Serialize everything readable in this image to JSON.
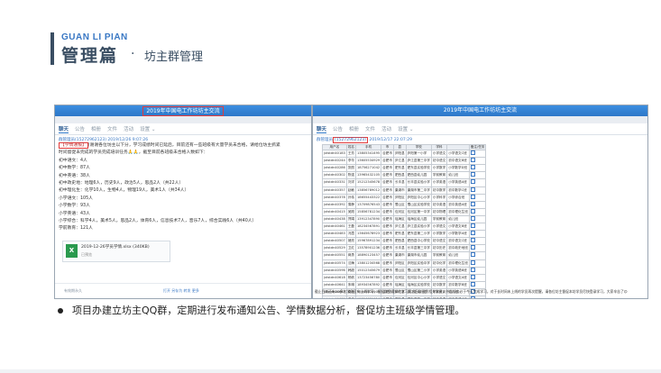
{
  "header": {
    "sub": "GUAN LI PIAN",
    "title": "管理篇",
    "dot": "·",
    "section": "坊主群管理"
  },
  "left_shot": {
    "window_title": "2019年中国电工作坊坊主交流",
    "tabs": [
      "聊天",
      "公告",
      "相册",
      "文件",
      "活动",
      "设置"
    ],
    "tab_suffix": "⌄",
    "meta": "群管理员(15272962123) 2019/12/26 9:07:26",
    "post_tag": "【学情通报】",
    "post_lines": [
      "(谢谢各位坊主以下分，学习成绩时间已延后，目前还有一些班级有大量学员未合格，请给位坊主抓紧",
      "时间督促未完成的学员完成培训任务🙏🙏，截至目前各班级未合格人数如下：",
      "初中语文：4人",
      "初中数学：87人",
      "初中英语：38人",
      "初中政史地：地理6人，历史9人，政治5人，思品2人（共22人）",
      "初中理化生：化学10人，生物4人，物理19人，美术1人（共34人）",
      "小学语文：105人",
      "小学数学：93人",
      "小学英语：43人",
      "小学综合：科学4人，美术5人，思品2人，体育6人，信息技术7人，音乐7人，综合实践6人（共40人）",
      "学前教育：121人"
    ],
    "file": {
      "icon": "X",
      "name": "2019-12-26学员学情.xlsx",
      "size": "(340KB)",
      "status": "已预览"
    },
    "footer_left": "有效期永久",
    "footer_right": "打开  另存为  转发  更多"
  },
  "right_shot": {
    "window_title": "2019年中国电工作坊坊主交流",
    "tabs": [
      "聊天",
      "公告",
      "相册",
      "文件",
      "活动",
      "设置"
    ],
    "tab_suffix": "⌄",
    "meta_prefix": "群管理员",
    "meta_hl": "(15272962123)",
    "meta_time": "2019/12/17 22:07:29",
    "columns": [
      "用户名",
      "姓名",
      "手机",
      "市",
      "县",
      "学校",
      "学科",
      "",
      "备注/任务"
    ],
    "rows": [
      [
        "jxtstdn40183",
        "王芳",
        "13805341495",
        "合肥市",
        "庐阳县",
        "庐阳第一小学",
        "小学语文",
        "小学语文C班",
        ""
      ],
      [
        "jxtstdn40244",
        "李华",
        "13605534929",
        "合肥市",
        "庐江县",
        "庐江县第三中学",
        "初中语文",
        "初中语文B班",
        ""
      ],
      [
        "jxtstdn40286",
        "张丽",
        "18756271042",
        "合肥市",
        "肥东县",
        "肥东县实验学校",
        "小学数学",
        "小学数学D班",
        ""
      ],
      [
        "jxtstdn40302",
        "陈强",
        "13965432105",
        "合肥市",
        "肥西县",
        "肥西县幼儿园",
        "学前教育",
        "幼儿班",
        ""
      ],
      [
        "jxtstdn40331",
        "刘洋",
        "15212345678",
        "合肥市",
        "长丰县",
        "长丰县实验小学",
        "小学英语",
        "小学英语A班",
        ""
      ],
      [
        "jxtstdn40357",
        "赵敏",
        "13856789012",
        "合肥市",
        "巢湖市",
        "巢湖市第二中学",
        "初中数学",
        "初中数学C班",
        ""
      ],
      [
        "jxtstdn40378",
        "孙伟",
        "18655443322",
        "合肥市",
        "庐阳区",
        "庐阳区中心小学",
        "小学科学",
        "小学综合班",
        ""
      ],
      [
        "jxtstdn40392",
        "周静",
        "13709876543",
        "合肥市",
        "蜀山区",
        "蜀山区实验学校",
        "初中英语",
        "初中英语A班",
        ""
      ],
      [
        "jxtstdn40415",
        "吴刚",
        "15856781234",
        "合肥市",
        "包河区",
        "包河区第一中学",
        "初中物理",
        "初中理化生班",
        ""
      ],
      [
        "jxtstdn40438",
        "郑娟",
        "13912347890",
        "合肥市",
        "瑶海区",
        "瑶海区幼儿园",
        "学前教育",
        "幼儿班",
        ""
      ],
      [
        "jxtstdn40461",
        "王磊",
        "18234567891",
        "合肥市",
        "庐江县",
        "庐江县实验小学",
        "小学语文",
        "小学语文B班",
        ""
      ],
      [
        "jxtstdn40483",
        "冯霞",
        "13645678923",
        "合肥市",
        "肥东县",
        "肥东县第二小学",
        "小学数学",
        "小学数学A班",
        ""
      ],
      [
        "jxtstdn40507",
        "褚亮",
        "15967891234",
        "合肥市",
        "肥西县",
        "肥西县中心学校",
        "初中语文",
        "初中语文C班",
        ""
      ],
      [
        "jxtstdn40529",
        "卫红",
        "13578901236",
        "合肥市",
        "长丰县",
        "长丰县第三中学",
        "初中历史",
        "初中政史地班",
        ""
      ],
      [
        "jxtstdn40551",
        "蒋勇",
        "18890123457",
        "合肥市",
        "巢湖市",
        "巢湖市幼儿园",
        "学前教育",
        "幼儿班",
        ""
      ],
      [
        "jxtstdn40574",
        "沈梅",
        "13801234568",
        "合肥市",
        "庐阳区",
        "庐阳区实验中学",
        "初中化学",
        "初中理化生班",
        ""
      ],
      [
        "jxtstdn40596",
        "韩超",
        "15012345679",
        "合肥市",
        "蜀山区",
        "蜀山区第二小学",
        "小学英语",
        "小学英语B班",
        ""
      ],
      [
        "jxtstdn40618",
        "杨帆",
        "13723456780",
        "合肥市",
        "包河区",
        "包河区中心小学",
        "小学语文",
        "小学语文A班",
        ""
      ],
      [
        "jxtstdn40641",
        "朱琳",
        "18934567892",
        "合肥市",
        "瑶海区",
        "瑶海区实验学校",
        "初中数学",
        "初中数学B班",
        ""
      ],
      [
        "jxtstdn40663",
        "秦峰",
        "13645678903",
        "合肥市",
        "庐江县",
        "庐江县幼儿园",
        "学前教育",
        "幼儿班",
        ""
      ],
      [
        "jxtstdn40685",
        "尤佳",
        "15856789014",
        "合肥市",
        "肥东县",
        "肥东县第一中学",
        "初中英语",
        "初中英语C班",
        ""
      ],
      [
        "jxtstdn40707",
        "许涛",
        "13967890125",
        "合肥市",
        "肥西县",
        "肥西县实验小学",
        "小学数学",
        "小学数学C班",
        ""
      ],
      [
        "jxtstdn40729",
        "何静",
        "18278901236",
        "合肥市",
        "长丰县",
        "长丰县中心小学",
        "小学科学",
        "小学综合班",
        ""
      ],
      [
        "jxtstdn40751",
        "吕明",
        "13589012347",
        "合肥市",
        "巢湖市",
        "巢湖市实验学校",
        "初中生物",
        "初中理化生班",
        ""
      ],
      [
        "jxtstdn40773",
        "施敏",
        "15090123458",
        "合肥市",
        "庐阳区",
        "庐阳区幼儿园",
        "学前教育",
        "幼儿班",
        ""
      ],
      [
        "jxtstdn40795",
        "张伟",
        "13701234569",
        "合肥市",
        "蜀山区",
        "蜀山区第一中学",
        "初中地理",
        "初中政史地班",
        ""
      ],
      [
        "jxtstdn40817",
        "孔丽",
        "18812345670",
        "合肥市",
        "包河区",
        "包河区实验小学",
        "小学英语",
        "小学英语C班",
        ""
      ],
      [
        "jxtstdn40839",
        "曹阳",
        "13923456781",
        "合肥市",
        "瑶海区",
        "瑶海区第二小学",
        "小学语文",
        "小学语文D班",
        ""
      ],
      [
        "jxtstdn40861",
        "严华",
        "15634567892",
        "合肥市",
        "庐江县",
        "庐江县第一中学",
        "初中政治",
        "初中政史地班",
        ""
      ],
      [
        "jxtstdn40883",
        "华强",
        "13545678903",
        "合肥市",
        "肥东县",
        "肥东县幼儿园",
        "学前教育",
        "幼儿班",
        ""
      ]
    ],
    "note": "截止目前还有20多名学员没有上线学习，根据群里通知的学习要求已联系到相关学员，并告知务必于今天完成学习，对于长时间未上线的学员再次提醒，请各位坊主督促本坊学员尽快登录学习，大家辛苦了😊"
  },
  "bullet": {
    "text": "项目办建立坊主QQ群，定期进行发布通知公告、学情数据分析，督促坊主班级学情管理。"
  }
}
